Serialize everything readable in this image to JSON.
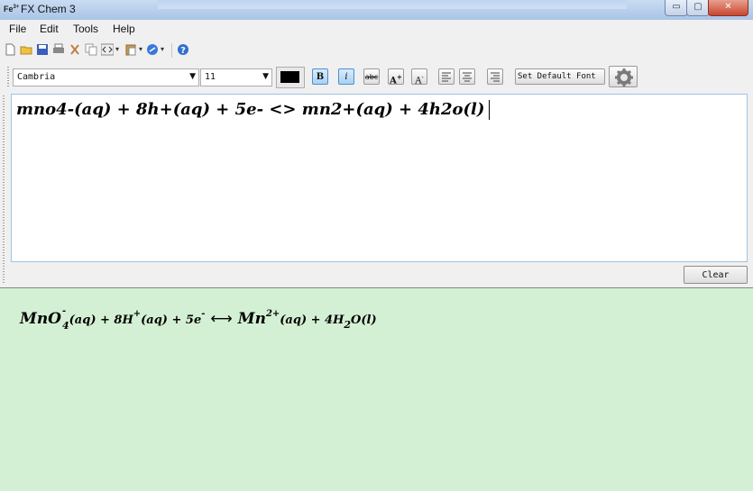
{
  "window": {
    "icon_text": "Fe",
    "icon_sup": "3+",
    "title": "FX Chem 3",
    "minimize_glyph": "▭",
    "maximize_glyph": "▢",
    "close_glyph": "✕"
  },
  "menu": [
    "File",
    "Edit",
    "Tools",
    "Help"
  ],
  "toolbar_icons": [
    "new-document-icon",
    "open-folder-icon",
    "save-icon",
    "print-icon",
    "cut-icon",
    "copy-icon",
    "code-icon",
    "paste-icon",
    "link-icon",
    "help-icon"
  ],
  "format": {
    "font_name": "Cambria",
    "font_size": "11",
    "color": "#000000",
    "bold_label": "B",
    "italic_label": "i",
    "strike_label": "abc",
    "grow_label": "A",
    "shrink_label": "A",
    "set_default_font_label": "Set Default Font"
  },
  "editor": {
    "text": "mno4-(aq) + 8h+(aq) + 5e- <> mn2+(aq) + 4h2o(l)"
  },
  "clear_label": "Clear",
  "output": {
    "mn": "MnO",
    "mn_sub": "4",
    "mn_sup": "-",
    "aq1": "(aq) + 8H",
    "h_sup": "+",
    "aq2": "(aq) + 5e",
    "e_sup": "-",
    "arrow": "⟷",
    "mn2": "Mn",
    "mn2_sup": "2+",
    "aq3": "(aq) + 4H",
    "h2_sub": "2",
    "o": "O(l)"
  },
  "colors": {
    "output_bg": "#d4f0d4",
    "editor_border": "#9bc3e6",
    "active_button": "#a9d2f2"
  }
}
